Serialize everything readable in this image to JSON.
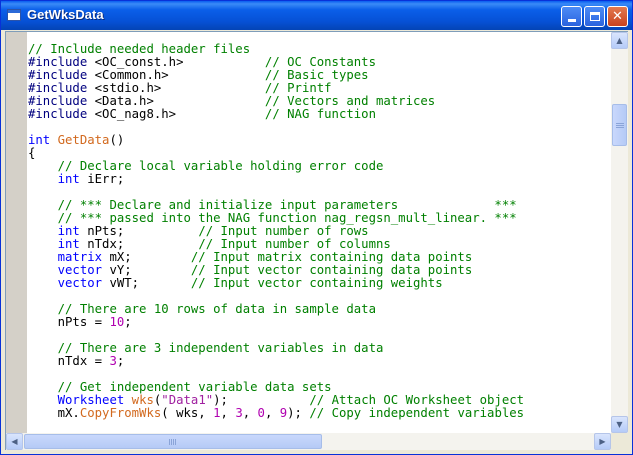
{
  "window": {
    "title": "GetWksData"
  },
  "titlebar_buttons": {
    "minimize": "minimize-icon",
    "maximize": "maximize-icon",
    "close": "close-icon"
  },
  "colors": {
    "comment": "#008000",
    "preproc": "#00007f",
    "keyword": "#0000ff",
    "function": "#d2691e",
    "string": "#a020a0",
    "number": "#b000b0"
  },
  "scrollbars": {
    "vertical": {
      "up": "▲",
      "down": "▼"
    },
    "horizontal": {
      "left": "◀",
      "right": "▶"
    }
  },
  "code_lines": [
    [
      {
        "t": "comment",
        "v": "// Include needed header files"
      }
    ],
    [
      {
        "t": "preproc",
        "v": "#include"
      },
      {
        "t": "text",
        "v": " <OC_const.h>           "
      },
      {
        "t": "comment",
        "v": "// OC Constants"
      }
    ],
    [
      {
        "t": "preproc",
        "v": "#include"
      },
      {
        "t": "text",
        "v": " <Common.h>             "
      },
      {
        "t": "comment",
        "v": "// Basic types"
      }
    ],
    [
      {
        "t": "preproc",
        "v": "#include"
      },
      {
        "t": "text",
        "v": " <stdio.h>              "
      },
      {
        "t": "comment",
        "v": "// Printf"
      }
    ],
    [
      {
        "t": "preproc",
        "v": "#include"
      },
      {
        "t": "text",
        "v": " <Data.h>               "
      },
      {
        "t": "comment",
        "v": "// Vectors and matrices"
      }
    ],
    [
      {
        "t": "preproc",
        "v": "#include"
      },
      {
        "t": "text",
        "v": " <OC_nag8.h>            "
      },
      {
        "t": "comment",
        "v": "// NAG function"
      }
    ],
    [],
    [
      {
        "t": "keyword",
        "v": "int"
      },
      {
        "t": "text",
        "v": " "
      },
      {
        "t": "function",
        "v": "GetData"
      },
      {
        "t": "text",
        "v": "()"
      }
    ],
    [
      {
        "t": "text",
        "v": "{"
      }
    ],
    [
      {
        "t": "text",
        "v": "    "
      },
      {
        "t": "comment",
        "v": "// Declare local variable holding error code"
      }
    ],
    [
      {
        "t": "text",
        "v": "    "
      },
      {
        "t": "keyword",
        "v": "int"
      },
      {
        "t": "text",
        "v": " iErr;"
      }
    ],
    [],
    [
      {
        "t": "text",
        "v": "    "
      },
      {
        "t": "comment",
        "v": "// *** Declare and initialize input parameters             ***"
      }
    ],
    [
      {
        "t": "text",
        "v": "    "
      },
      {
        "t": "comment",
        "v": "// *** passed into the NAG function nag_regsn_mult_linear. ***"
      }
    ],
    [
      {
        "t": "text",
        "v": "    "
      },
      {
        "t": "keyword",
        "v": "int"
      },
      {
        "t": "text",
        "v": " nPts;          "
      },
      {
        "t": "comment",
        "v": "// Input number of rows"
      }
    ],
    [
      {
        "t": "text",
        "v": "    "
      },
      {
        "t": "keyword",
        "v": "int"
      },
      {
        "t": "text",
        "v": " nTdx;          "
      },
      {
        "t": "comment",
        "v": "// Input number of columns"
      }
    ],
    [
      {
        "t": "text",
        "v": "    "
      },
      {
        "t": "keyword",
        "v": "matrix"
      },
      {
        "t": "text",
        "v": " mX;        "
      },
      {
        "t": "comment",
        "v": "// Input matrix containing data points"
      }
    ],
    [
      {
        "t": "text",
        "v": "    "
      },
      {
        "t": "keyword",
        "v": "vector"
      },
      {
        "t": "text",
        "v": " vY;        "
      },
      {
        "t": "comment",
        "v": "// Input vector containing data points"
      }
    ],
    [
      {
        "t": "text",
        "v": "    "
      },
      {
        "t": "keyword",
        "v": "vector"
      },
      {
        "t": "text",
        "v": " vWT;       "
      },
      {
        "t": "comment",
        "v": "// Input vector containing weights"
      }
    ],
    [],
    [
      {
        "t": "text",
        "v": "    "
      },
      {
        "t": "comment",
        "v": "// There are 10 rows of data in sample data"
      }
    ],
    [
      {
        "t": "text",
        "v": "    nPts = "
      },
      {
        "t": "number",
        "v": "10"
      },
      {
        "t": "text",
        "v": ";"
      }
    ],
    [],
    [
      {
        "t": "text",
        "v": "    "
      },
      {
        "t": "comment",
        "v": "// There are 3 independent variables in data"
      }
    ],
    [
      {
        "t": "text",
        "v": "    nTdx = "
      },
      {
        "t": "number",
        "v": "3"
      },
      {
        "t": "text",
        "v": ";"
      }
    ],
    [],
    [
      {
        "t": "text",
        "v": "    "
      },
      {
        "t": "comment",
        "v": "// Get independent variable data sets"
      }
    ],
    [
      {
        "t": "text",
        "v": "    "
      },
      {
        "t": "keyword",
        "v": "Worksheet"
      },
      {
        "t": "text",
        "v": " "
      },
      {
        "t": "function",
        "v": "wks"
      },
      {
        "t": "text",
        "v": "("
      },
      {
        "t": "string",
        "v": "\"Data1\""
      },
      {
        "t": "text",
        "v": ");           "
      },
      {
        "t": "comment",
        "v": "// Attach OC Worksheet object"
      }
    ],
    [
      {
        "t": "text",
        "v": "    mX."
      },
      {
        "t": "function",
        "v": "CopyFromWks"
      },
      {
        "t": "text",
        "v": "( wks, "
      },
      {
        "t": "number",
        "v": "1"
      },
      {
        "t": "text",
        "v": ", "
      },
      {
        "t": "number",
        "v": "3"
      },
      {
        "t": "text",
        "v": ", "
      },
      {
        "t": "number",
        "v": "0"
      },
      {
        "t": "text",
        "v": ", "
      },
      {
        "t": "number",
        "v": "9"
      },
      {
        "t": "text",
        "v": "); "
      },
      {
        "t": "comment",
        "v": "// Copy independent variables"
      }
    ]
  ]
}
